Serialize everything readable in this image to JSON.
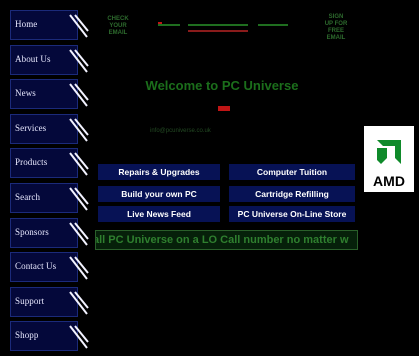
{
  "nav": {
    "items": [
      {
        "label": "Home"
      },
      {
        "label": "About Us"
      },
      {
        "label": "News"
      },
      {
        "label": "Services"
      },
      {
        "label": "Products"
      },
      {
        "label": "Search"
      },
      {
        "label": "Sponsors"
      },
      {
        "label": "Contact Us"
      },
      {
        "label": "Support"
      },
      {
        "label": "Shopp"
      }
    ]
  },
  "topbar": {
    "left_text": "CHECK\nYOUR\nEMAIL",
    "right_text": "SIGN\nUP FOR\nFREE\nEMAIL"
  },
  "main": {
    "welcome": "Welcome to PC Universe",
    "subline": "info@pcuniverse.co.uk",
    "buttons": [
      {
        "label": "Repairs & Upgrades"
      },
      {
        "label": "Computer Tuition"
      },
      {
        "label": "Build your own PC"
      },
      {
        "label": "Cartridge Refilling"
      },
      {
        "label": "Live News Feed"
      },
      {
        "label": "PC Universe On-Line Store"
      }
    ],
    "marquee": "all PC Universe on a LO Call number no matter w",
    "amd_text": "AMD"
  },
  "colors": {
    "nav_bg": "#04083a",
    "button_bg": "#071255",
    "welcome_green": "#1b6e1b",
    "accent_red": "#c01515"
  }
}
